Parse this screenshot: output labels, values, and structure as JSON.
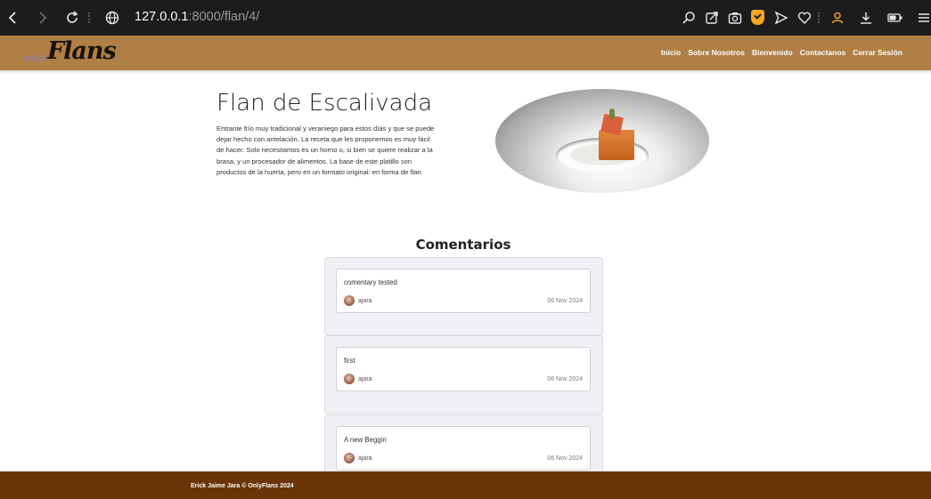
{
  "browser": {
    "url_host": "127.0.0.1",
    "url_path": ":8000/flan/4/",
    "icons": [
      "back-icon",
      "forward-icon",
      "reload-icon",
      "globe-icon",
      "zoom-icon",
      "share-icon",
      "camera-icon",
      "shield-icon",
      "send-icon",
      "heart-icon",
      "user-icon",
      "download-icon",
      "battery-icon",
      "menu-icon"
    ]
  },
  "brand": {
    "small": "ONLY",
    "big": "Flans"
  },
  "nav": [
    "Inicio",
    "Sobre Nosotros",
    "Bienvenido",
    "Contactanos",
    "Cerrar Sesión"
  ],
  "flan": {
    "title": "Flan de Escalivada",
    "description": "Entrante frío muy tradicional y veraniego para estos días y que se puede dejar hecho con antelación. La receta que les proponemos es muy fácil de hacer. Solo necesitamos es un horno o, si bien se quiere realizar a la brasa, y un procesador de alimentos. La base de este platillo son productos de la huerta, pero en un formato original: en forma de flan."
  },
  "comments": {
    "title": "Comentarios",
    "items": [
      {
        "text": "comentary tested",
        "user": "ajara",
        "date": "06 Nov 2024"
      },
      {
        "text": "first",
        "user": "ajara",
        "date": "06 Nov 2024"
      },
      {
        "text": "A new Beggin",
        "user": "ajara",
        "date": "06 Nov 2024"
      }
    ]
  },
  "footer": {
    "text": "Erick Jaime Jara © OnlyFlans 2024"
  },
  "colors": {
    "navbar": "#b07f45",
    "footer": "#6a3406",
    "chrome": "#1c1c1e",
    "accent": "#f5a623"
  }
}
